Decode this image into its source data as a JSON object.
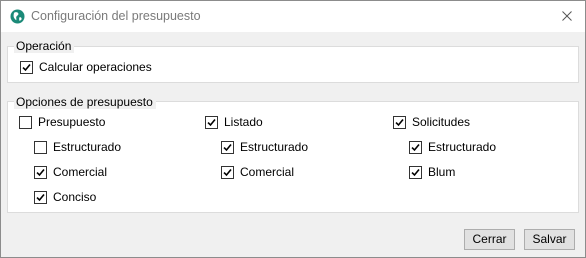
{
  "window": {
    "title": "Configuración del presupuesto",
    "icon": "app-globe-icon",
    "close_icon": "close-icon",
    "accent_color": "#1b8a78"
  },
  "operacion": {
    "legend": "Operación",
    "calcular": {
      "label": "Calcular operaciones",
      "checked": true
    }
  },
  "opciones": {
    "legend": "Opciones de presupuesto",
    "presupuesto": {
      "label": "Presupuesto",
      "checked": false,
      "estructurado": {
        "label": "Estructurado",
        "checked": false
      },
      "comercial": {
        "label": "Comercial",
        "checked": true
      },
      "conciso": {
        "label": "Conciso",
        "checked": true
      }
    },
    "listado": {
      "label": "Listado",
      "checked": true,
      "estructurado": {
        "label": "Estructurado",
        "checked": true
      },
      "comercial": {
        "label": "Comercial",
        "checked": true
      }
    },
    "solicitudes": {
      "label": "Solicitudes",
      "checked": true,
      "estructurado": {
        "label": "Estructurado",
        "checked": true
      },
      "blum": {
        "label": "Blum",
        "checked": true
      }
    }
  },
  "buttons": {
    "cerrar": "Cerrar",
    "salvar": "Salvar"
  }
}
